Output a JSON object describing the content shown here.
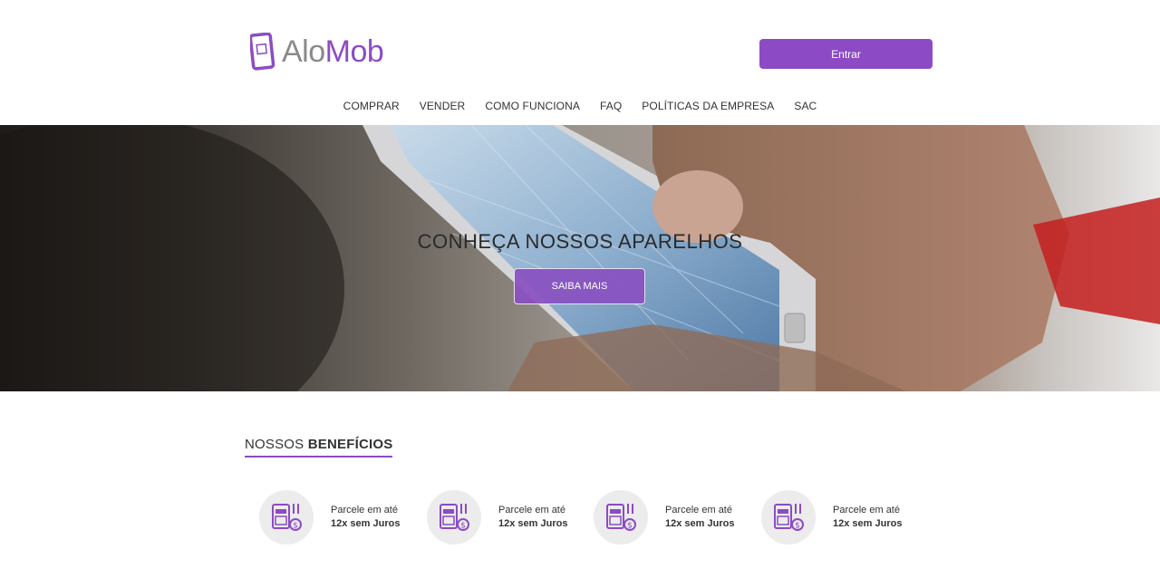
{
  "brand": {
    "name_part1": "Alo",
    "name_part2": "Mob"
  },
  "header": {
    "login_label": "Entrar"
  },
  "nav": [
    "COMPRAR",
    "VENDER",
    "COMO FUNCIONA",
    "FAQ",
    "POLÍTICAS DA EMPRESA",
    "SAC"
  ],
  "hero": {
    "title": "CONHEÇA NOSSOS APARELHOS",
    "cta": "SAIBA MAIS"
  },
  "benefits": {
    "title_light": "NOSSOS ",
    "title_bold": "BENEFÍCIOS",
    "items": [
      {
        "line1": "Parcele em até",
        "line2": "12x sem Juros",
        "icon": "installment-icon"
      },
      {
        "line1": "Parcele em até",
        "line2": "12x sem Juros",
        "icon": "installment-icon"
      },
      {
        "line1": "Parcele em até",
        "line2": "12x sem Juros",
        "icon": "installment-icon"
      },
      {
        "line1": "Parcele em até",
        "line2": "12x sem Juros",
        "icon": "installment-icon"
      }
    ]
  },
  "colors": {
    "accent": "#8c4bc5",
    "text": "#333333"
  }
}
